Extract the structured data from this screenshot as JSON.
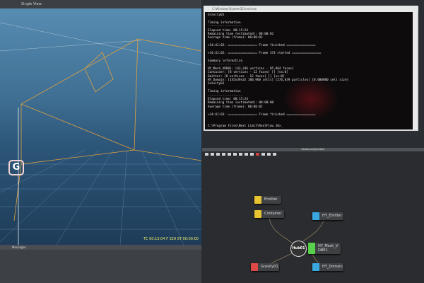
{
  "viewport": {
    "title": "Single View",
    "status": "TC 00:13:04   F 329   ST 00:00:00",
    "gravity_glyph": "G"
  },
  "messages": {
    "title": "Messages"
  },
  "console": {
    "title": "C:\\Windows\\System32\\cmd.exe",
    "lines": [
      "Gravity01",
      "",
      "Timing information",
      "-------------------",
      "Elapsed time: 00:15:24",
      "Remaining time (estimated): 00:00:02",
      "Average time (frame): 00:00:02",
      "",
      ">14:41:02: ================ Frame finished ================",
      "",
      ">14:41:02: ================ Frame 374 started ================",
      "",
      "Summary information",
      "-------------------",
      "HY_Mesh_VDB01: [43,346 vertices - 85,964 faces]",
      "Container: [8 vertices - 12 faces] [] [vx:0]",
      "Emitter: [8 vertices - 12 faces] [] [vx:0]",
      "HY_Domain: [145x39x32 180,960 cells] [276,839 particles] [0.000000 cell size]",
      "Gravity01",
      "",
      "Timing information",
      "-------------------",
      "Elapsed time: 00:15:24",
      "Remaining time (estimated): 00:00:00",
      "Average time (frame): 00:00:02",
      "",
      ">14:41:03: ================ Frame finished ================",
      "",
      "",
      "C:\\Program Files\\Next Limit\\RealFlow 10>_"
    ]
  },
  "relationship_editor": {
    "title": "Relationship Editor",
    "nodes": {
      "emitter": "Emitter",
      "container": "Container",
      "hy_emitter": "HY_Emitter",
      "hub": "Hub01",
      "hy_mesh": "HY_Mesh_VDB01",
      "gravity": "Gravity01",
      "hy_domain": "HY_Domain"
    },
    "colors": {
      "yellow": "#e8c431",
      "blue": "#3aa8e0",
      "green": "#58d04a",
      "red": "#e04848"
    }
  }
}
